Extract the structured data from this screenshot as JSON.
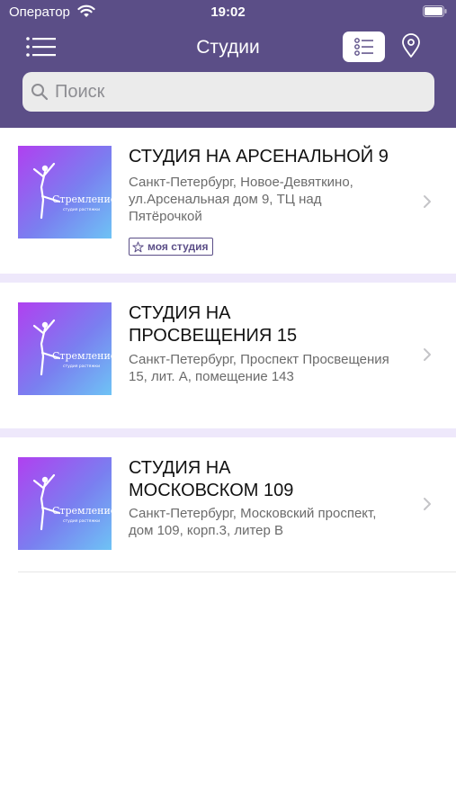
{
  "status_bar": {
    "carrier": "Оператор",
    "time": "19:02"
  },
  "nav": {
    "title": "Студии"
  },
  "search": {
    "placeholder": "Поиск",
    "value": ""
  },
  "colors": {
    "header": "#5b4e87",
    "separator": "#eee8fb",
    "accent": "#5b4e87",
    "thumb_gradient": [
      "#b040f0",
      "#7a7ff0",
      "#6ec3f5"
    ]
  },
  "thumbnail": {
    "brand_text": "Стремление",
    "brand_subtext": "студия растяжки"
  },
  "studios": [
    {
      "name": "СТУДИЯ НА АРСЕНАЛЬНОЙ 9",
      "address": "Санкт-Петербург, Новое-Девяткино, ул.Арсенальная дом 9, ТЦ над Пятёрочкой",
      "badge": "моя студия"
    },
    {
      "name": "СТУДИЯ НА ПРОСВЕЩЕНИЯ 15",
      "address": "Санкт-Петербург, Проспект Просвещения 15, лит. А, помещение 143"
    },
    {
      "name": "СТУДИЯ НА МОСКОВСКОМ 109",
      "address": "Санкт-Петербург, Московский проспект, дом 109, корп.3, литер В"
    }
  ]
}
